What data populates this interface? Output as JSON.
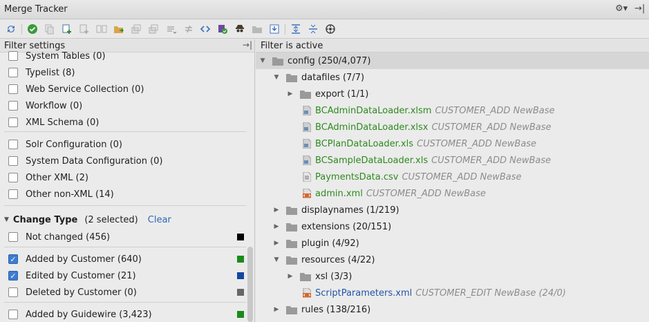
{
  "window": {
    "title": "Merge Tracker",
    "gear_glyph": "⚙▾",
    "hide_glyph": "→|"
  },
  "toolbar": {
    "icons": [
      "refresh-icon",
      "accept-icon",
      "copy-icon",
      "add-icon",
      "duplicate-icon",
      "compare-icon",
      "move-icon",
      "stack-icon",
      "stack2-icon",
      "list-icon",
      "not-equal-icon",
      "code-icon",
      "check-file-icon",
      "spy-icon",
      "folder-icon",
      "export-icon",
      "expand-all-icon",
      "collapse-all-icon",
      "settings-circle-icon"
    ]
  },
  "filter_settings": {
    "title": "Filter settings",
    "pin_glyph": "→|",
    "items_top": [
      {
        "label": "System Tables (0)",
        "checked": false
      },
      {
        "label": "Typelist (8)",
        "checked": false
      },
      {
        "label": "Web Service Collection (0)",
        "checked": false
      },
      {
        "label": "Workflow (0)",
        "checked": false
      },
      {
        "label": "XML Schema (0)",
        "checked": false
      },
      {
        "label": "Solr Configuration (0)",
        "checked": false
      },
      {
        "label": "System Data Configuration (0)",
        "checked": false
      },
      {
        "label": "Other XML (2)",
        "checked": false
      },
      {
        "label": "Other non-XML (14)",
        "checked": false
      }
    ],
    "change_type": {
      "name": "Change Type",
      "selected": "(2 selected)",
      "clear": "Clear",
      "items": [
        {
          "label": "Not changed (456)",
          "checked": false,
          "color": "#000000"
        },
        {
          "label": "Added by Customer (640)",
          "checked": true,
          "color": "#1a8a1a"
        },
        {
          "label": "Edited by Customer (21)",
          "checked": true,
          "color": "#1446a0"
        },
        {
          "label": "Deleted by Customer (0)",
          "checked": false,
          "color": "#666666"
        },
        {
          "label": "Added by Guidewire (3,423)",
          "checked": false,
          "color": "#1a8a1a"
        }
      ]
    }
  },
  "tree": {
    "title": "Filter is active",
    "rows": [
      {
        "kind": "folder",
        "name": "config (250/4,077)",
        "open": true,
        "selected": true
      },
      {
        "kind": "folder",
        "name": "datafiles (7/7)",
        "open": true
      },
      {
        "kind": "folder",
        "name": "export (1/1)",
        "open": false
      },
      {
        "kind": "file",
        "icon": "spreadsheet-icon",
        "name": "BCAdminDataLoader.xlsm",
        "meta": "CUSTOMER_ADD NewBase",
        "color": "green"
      },
      {
        "kind": "file",
        "icon": "spreadsheet-icon",
        "name": "BCAdminDataLoader.xlsx",
        "meta": "CUSTOMER_ADD NewBase",
        "color": "green"
      },
      {
        "kind": "file",
        "icon": "spreadsheet-icon",
        "name": "BCPlanDataLoader.xls",
        "meta": "CUSTOMER_ADD NewBase",
        "color": "green"
      },
      {
        "kind": "file",
        "icon": "spreadsheet-icon",
        "name": "BCSampleDataLoader.xls",
        "meta": "CUSTOMER_ADD NewBase",
        "color": "green"
      },
      {
        "kind": "file",
        "icon": "text-file-icon",
        "name": "PaymentsData.csv",
        "meta": "CUSTOMER_ADD NewBase",
        "color": "green"
      },
      {
        "kind": "file",
        "icon": "xml-file-icon",
        "name": "admin.xml",
        "meta": "CUSTOMER_ADD NewBase",
        "color": "green"
      },
      {
        "kind": "folder",
        "name": "displaynames (1/219)",
        "open": false
      },
      {
        "kind": "folder",
        "name": "extensions (20/151)",
        "open": false
      },
      {
        "kind": "folder",
        "name": "plugin (4/92)",
        "open": false
      },
      {
        "kind": "folder",
        "name": "resources (4/22)",
        "open": true
      },
      {
        "kind": "folder",
        "name": "xsl (3/3)",
        "open": false
      },
      {
        "kind": "file",
        "icon": "xml-file-icon",
        "name": "ScriptParameters.xml",
        "meta": "CUSTOMER_EDIT NewBase (24/0)",
        "color": "blue"
      },
      {
        "kind": "folder",
        "name": "rules (138/216)",
        "open": false
      }
    ]
  }
}
